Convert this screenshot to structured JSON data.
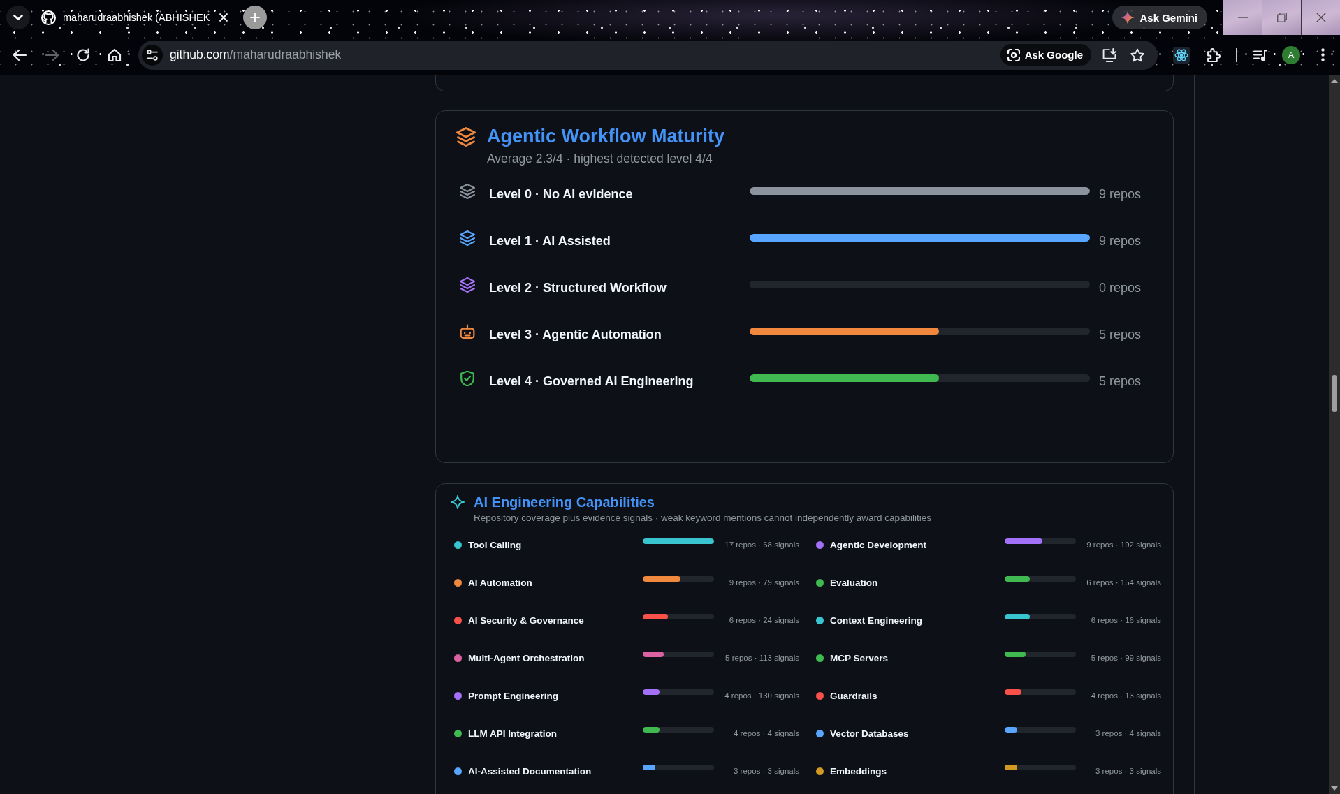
{
  "browser": {
    "tab": {
      "title": "maharudraabhishek (ABHISHEK"
    },
    "gemini_button": "Ask Gemini",
    "nav_buttons": [
      {
        "kind": "back",
        "disabled": false
      },
      {
        "kind": "forward",
        "disabled": true
      },
      {
        "kind": "reload",
        "disabled": false
      },
      {
        "kind": "home",
        "disabled": false
      }
    ],
    "address": {
      "host": "github.com",
      "path": "/maharudraabhishek"
    },
    "ask_google_button": "Ask Google",
    "profile_initial": "A"
  },
  "maturity": {
    "title": "Agentic Workflow Maturity",
    "subtitle": "Average 2.3/4 · highest detected level 4/4",
    "levels": [
      {
        "label": "Level 0 · No AI evidence",
        "kind": "layers",
        "color": "#8b949e",
        "level": 1,
        "reading": "9 repos"
      },
      {
        "label": "Level 1 · AI Assisted",
        "kind": "layers",
        "color": "#58a6ff",
        "level": 1,
        "reading": "9 repos"
      },
      {
        "label": "Level 2 · Structured Workflow",
        "kind": "layers",
        "color": "#a371f7",
        "level": 0,
        "reading": "0 repos"
      },
      {
        "label": "Level 3 · Agentic Automation",
        "kind": "robot",
        "color": "#f0883e",
        "level": 0.556,
        "reading": "5 repos"
      },
      {
        "label": "Level 4 · Governed AI Engineering",
        "kind": "shield",
        "color": "#3fb950",
        "level": 0.556,
        "reading": "5 repos"
      }
    ]
  },
  "capabilities": {
    "title": "AI Engineering Capabilities",
    "subtitle": "Repository coverage plus evidence signals · weak keyword mentions cannot independently award capabilities",
    "items": [
      {
        "name": "Tool Calling",
        "color": "#39c5cf",
        "level": 1,
        "reading": "17 repos · 68 signals"
      },
      {
        "name": "Agentic Development",
        "color": "#a371f7",
        "level": 0.53,
        "reading": "9 repos · 192 signals"
      },
      {
        "name": "AI Automation",
        "color": "#f0883e",
        "level": 0.53,
        "reading": "9 repos · 79 signals"
      },
      {
        "name": "Evaluation",
        "color": "#3fb950",
        "level": 0.35,
        "reading": "6 repos · 154 signals"
      },
      {
        "name": "AI Security & Governance",
        "color": "#f85149",
        "level": 0.35,
        "reading": "6 repos · 24 signals"
      },
      {
        "name": "Context Engineering",
        "color": "#39c5cf",
        "level": 0.35,
        "reading": "6 repos · 16 signals"
      },
      {
        "name": "Multi-Agent Orchestration",
        "color": "#db61a2",
        "level": 0.29,
        "reading": "5 repos · 113 signals"
      },
      {
        "name": "MCP Servers",
        "color": "#3fb950",
        "level": 0.29,
        "reading": "5 repos · 99 signals"
      },
      {
        "name": "Prompt Engineering",
        "color": "#a371f7",
        "level": 0.24,
        "reading": "4 repos · 130 signals"
      },
      {
        "name": "Guardrails",
        "color": "#f85149",
        "level": 0.24,
        "reading": "4 repos · 13 signals"
      },
      {
        "name": "LLM API Integration",
        "color": "#3fb950",
        "level": 0.24,
        "reading": "4 repos · 4 signals"
      },
      {
        "name": "Vector Databases",
        "color": "#58a6ff",
        "level": 0.18,
        "reading": "3 repos · 4 signals"
      },
      {
        "name": "AI-Assisted Documentation",
        "color": "#58a6ff",
        "level": 0.18,
        "reading": "3 repos · 3 signals"
      },
      {
        "name": "Embeddings",
        "color": "#d29922",
        "level": 0.18,
        "reading": "3 repos · 3 signals"
      }
    ]
  }
}
